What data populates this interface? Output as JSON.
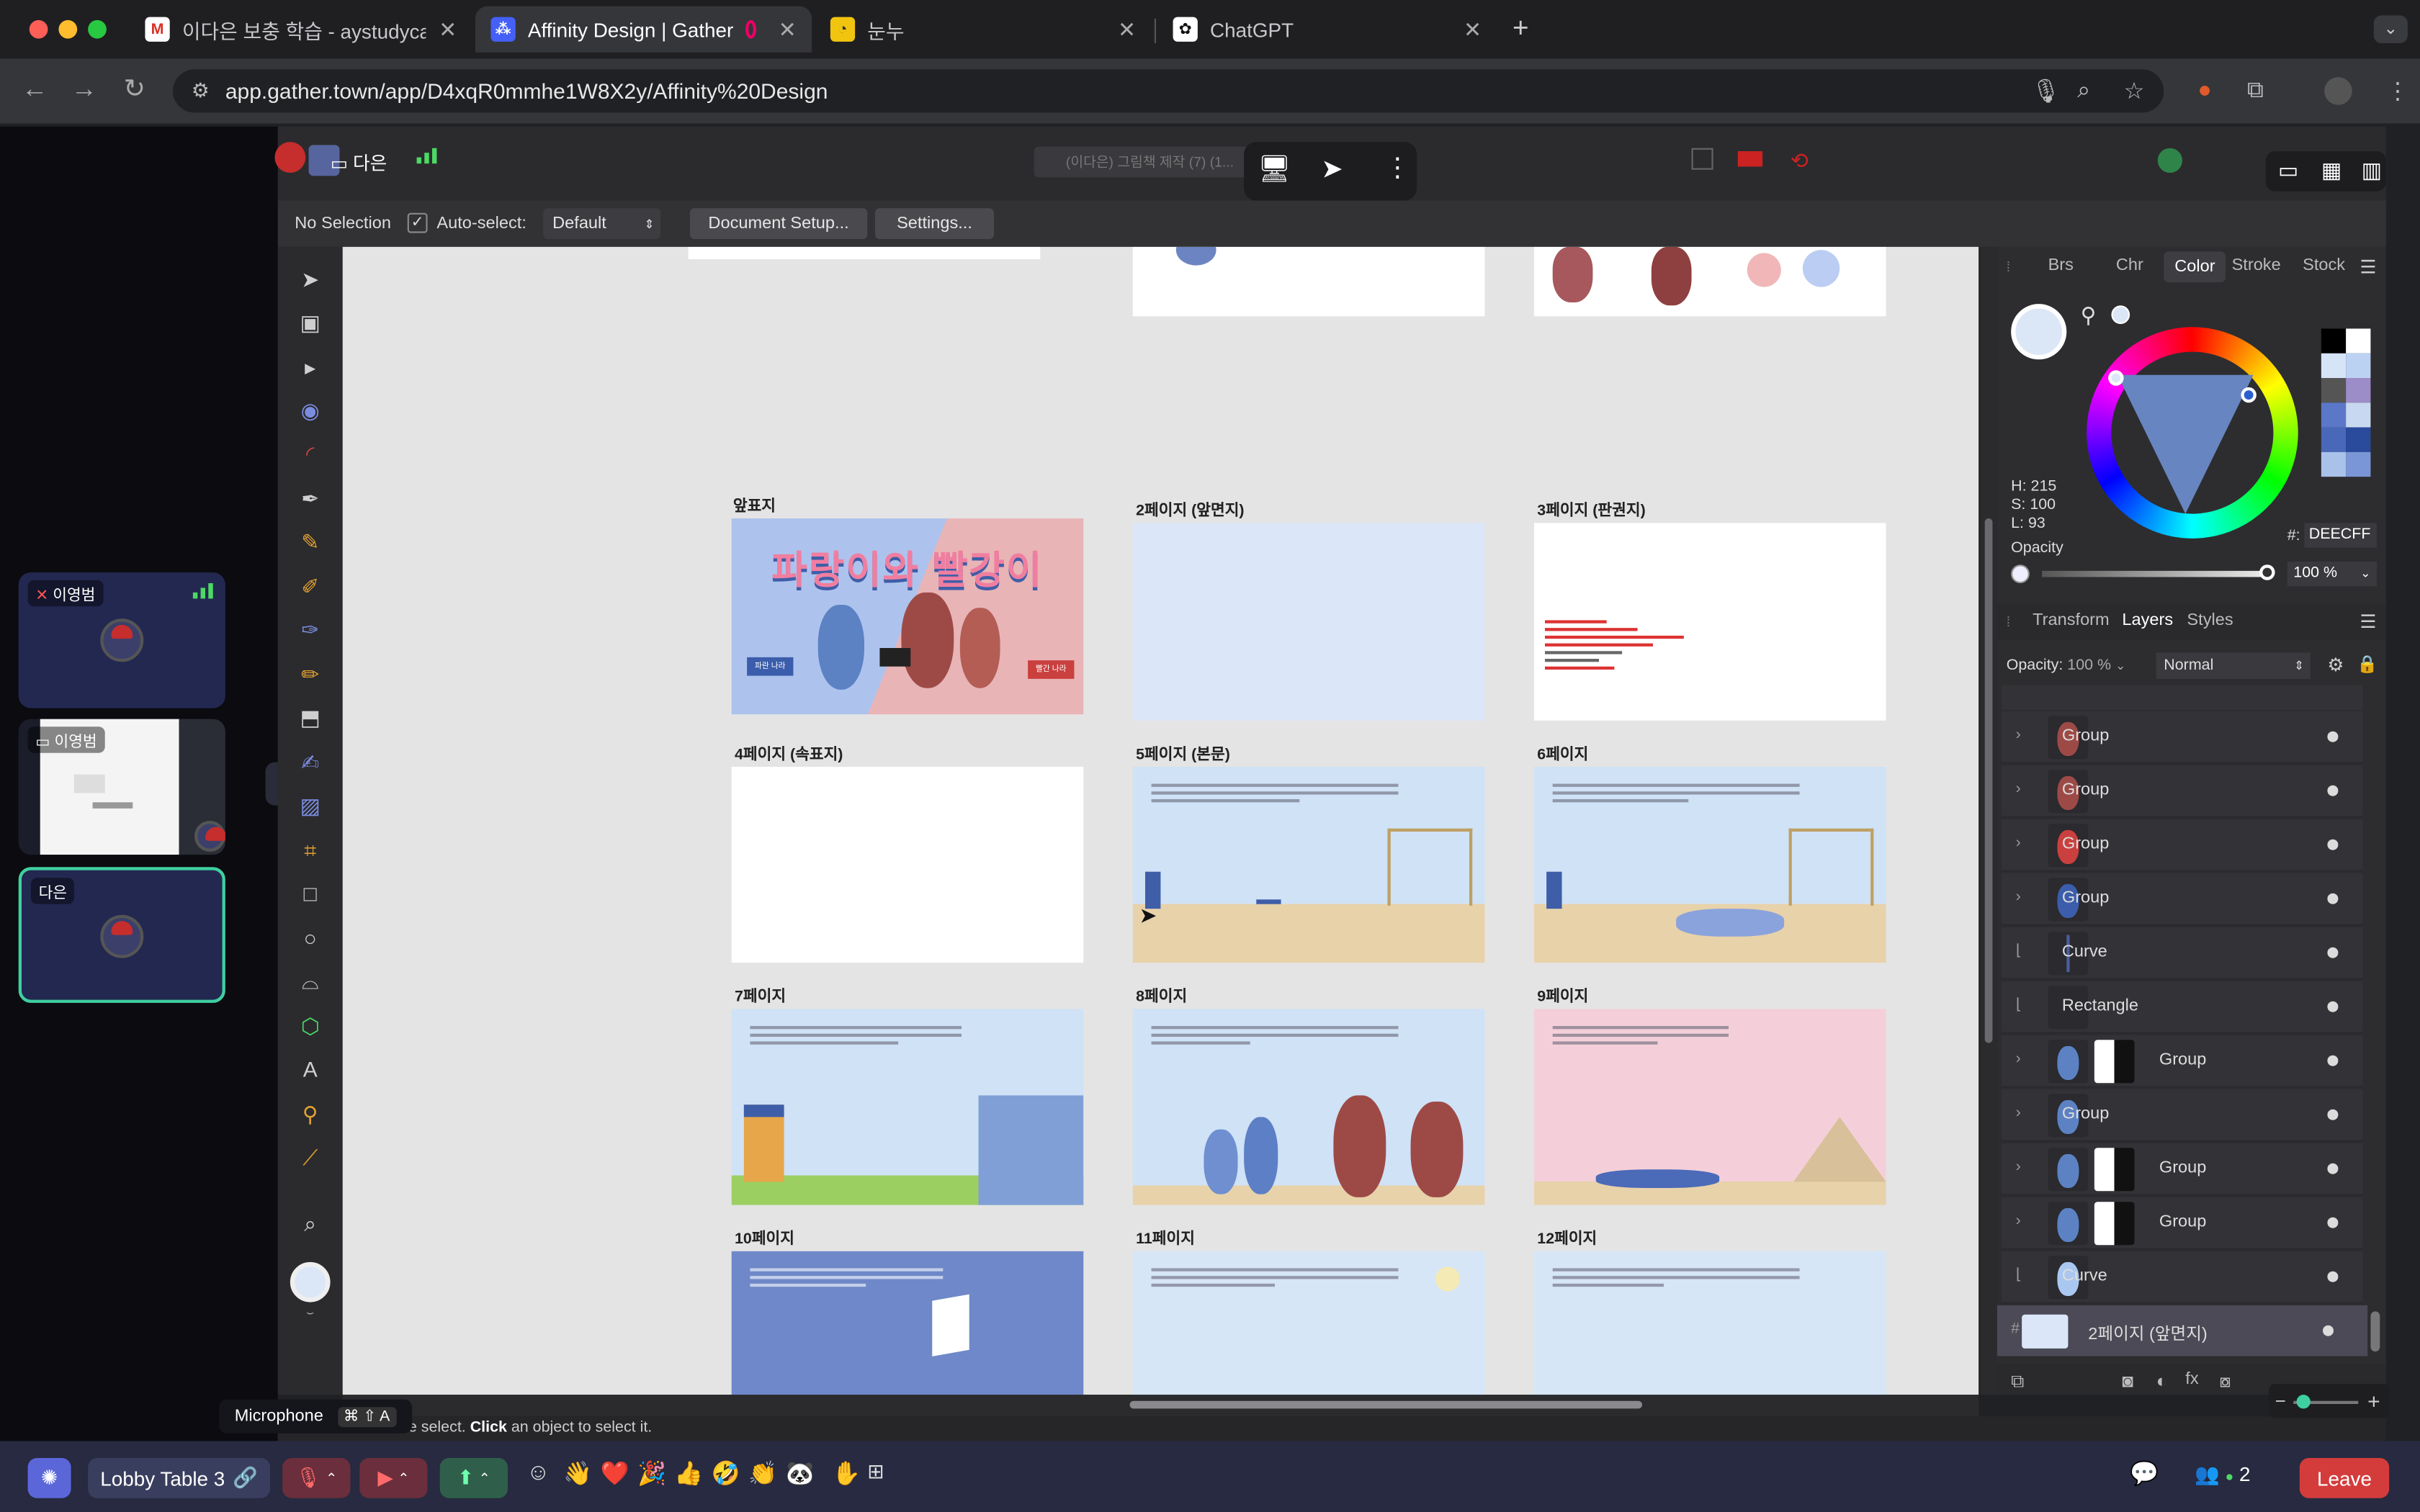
{
  "browser": {
    "tabs": [
      {
        "title": "이다은 보충 학습 - aystudycafe@",
        "favicon": "gmail-icon"
      },
      {
        "title": "Affinity Design | Gather",
        "favicon": "gather-icon"
      },
      {
        "title": "눈누",
        "favicon": "noonnu-icon"
      },
      {
        "title": "ChatGPT",
        "favicon": "chatgpt-icon"
      }
    ],
    "active_tab": 1,
    "url": "app.gather.town/app/D4xqR0mmhe1W8X2y/Affinity%20Design"
  },
  "gather": {
    "share_user": "다은",
    "room_title": "(이다은) 그림책 제작 (7) (1...",
    "participants": [
      {
        "name": "이영범",
        "type": "camera"
      },
      {
        "name": "이영범",
        "type": "screen"
      },
      {
        "name": "다은",
        "type": "camera"
      }
    ],
    "bottom": {
      "location": "Lobby Table 3",
      "participant_count": "2",
      "leave_label": "Leave",
      "tooltip_label": "Microphone",
      "tooltip_shortcut": "⌘ ⇧ A"
    }
  },
  "affinity": {
    "context": {
      "selection": "No Selection",
      "autoselect_label": "Auto-select:",
      "autoselect_value": "Default",
      "doc_setup": "Document Setup...",
      "settings": "Settings..."
    },
    "status_prefix": "ee select.",
    "status_bold": "Click",
    "status_suffix": "an object to select it.",
    "color_panel": {
      "tabs": [
        "Brs",
        "Chr",
        "Color",
        "Stroke",
        "Stock"
      ],
      "active": "Color",
      "h": "H: 215",
      "s": "S: 100",
      "l": "L: 93",
      "hex_label": "#:",
      "hex": "DEECFF",
      "opacity_label": "Opacity",
      "opacity_value": "100 %"
    },
    "layers_panel": {
      "tabs": [
        "Transform",
        "Layers",
        "Styles"
      ],
      "active": "Layers",
      "opacity_label": "Opacity:",
      "opacity_value": "100 %",
      "blend": "Normal",
      "layers": [
        {
          "name": "Group",
          "thumb": "figure-red"
        },
        {
          "name": "Group",
          "thumb": "figure-red"
        },
        {
          "name": "Group",
          "thumb": "sign-red"
        },
        {
          "name": "Group",
          "thumb": "sign-blue"
        },
        {
          "name": "Curve",
          "thumb": "curve"
        },
        {
          "name": "Rectangle",
          "thumb": "none"
        },
        {
          "name": "Group",
          "thumb": "figure-blue-mask"
        },
        {
          "name": "Group",
          "thumb": "figure-blue"
        },
        {
          "name": "Group",
          "thumb": "figure-blue-mask"
        },
        {
          "name": "Group",
          "thumb": "figure-blue-mask"
        },
        {
          "name": "Curve",
          "thumb": "shape-lightblue"
        },
        {
          "name": "2페이지 (앞면지)",
          "thumb": "page",
          "selected": true
        }
      ]
    },
    "artboards": [
      {
        "label": "앞표지",
        "title_text": "파랑이와 빨강이"
      },
      {
        "label": "2페이지 (앞면지)"
      },
      {
        "label": "3페이지 (판권지)"
      },
      {
        "label": "4페이지 (속표지)"
      },
      {
        "label": "5페이지 (본문)"
      },
      {
        "label": "6페이지"
      },
      {
        "label": "7페이지"
      },
      {
        "label": "8페이지"
      },
      {
        "label": "9페이지"
      },
      {
        "label": "10페이지"
      },
      {
        "label": "11페이지"
      },
      {
        "label": "12페이지"
      }
    ],
    "cover_signs": [
      "파란 나라",
      "빨간 나라"
    ]
  }
}
